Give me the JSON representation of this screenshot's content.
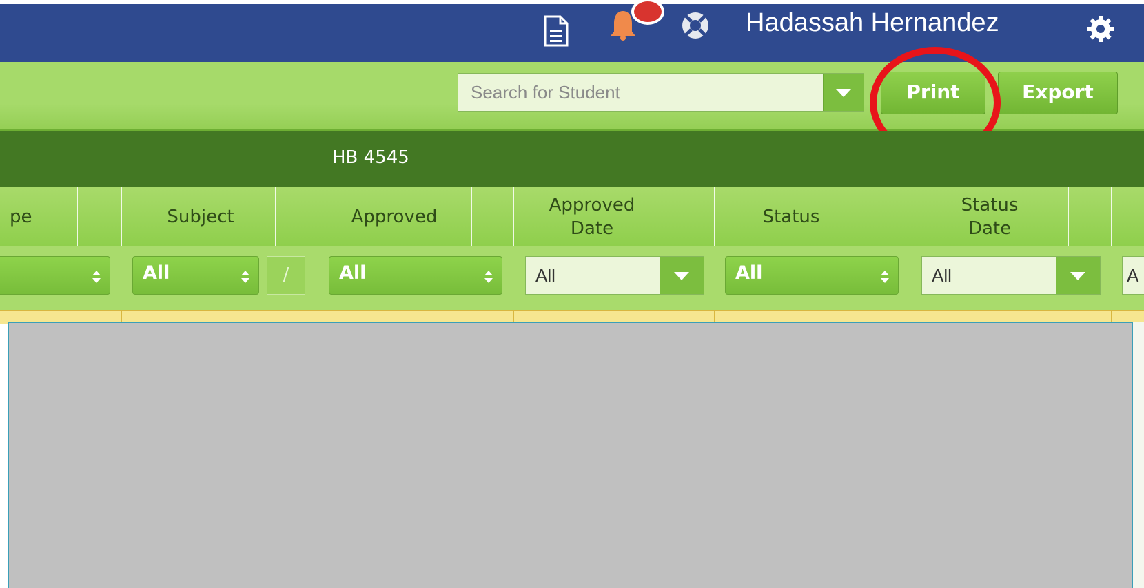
{
  "topbar": {
    "user_name": "Hadassah Hernandez",
    "icons": [
      "document-icon",
      "bell-icon",
      "help-icon",
      "gear-icon"
    ],
    "background_color": "#2f4a8f"
  },
  "toolbar": {
    "search_placeholder": "Search for Student",
    "print_label": "Print",
    "export_label": "Export"
  },
  "banner": {
    "title": "HB 4545"
  },
  "columns": [
    {
      "label": "pe"
    },
    {
      "label": "Subject"
    },
    {
      "label": "Approved"
    },
    {
      "label_line1": "Approved",
      "label_line2": "Date"
    },
    {
      "label": "Status"
    },
    {
      "label_line1": "Status",
      "label_line2": "Date"
    }
  ],
  "filters": {
    "subject": "All",
    "subject_slash": "/",
    "approved": "All",
    "approved_date": "All",
    "status": "All",
    "status_date": "All",
    "partial_next": "A"
  },
  "colors": {
    "accent_green": "#7cbe3f",
    "banner_green": "#437823",
    "highlight_circle": "#e8141a"
  }
}
